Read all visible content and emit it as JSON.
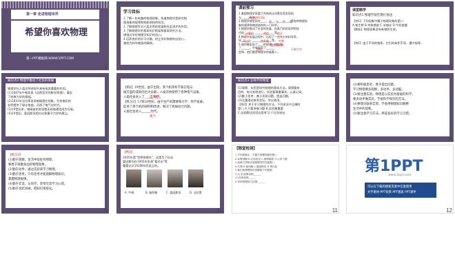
{
  "slides": [
    {
      "n": "1",
      "chapter": "第一章  走进物理世界",
      "title": "希望你喜欢物理",
      "footer": "第一PPT模板网-WWW.1PPT.COM"
    },
    {
      "n": "2",
      "heading": "学习目标",
      "lines": [
        "1.了解一些有趣的物理现象，知道物理学是研究物",
        "  理现象的规律和物质结构的科学。",
        "2.了解物理学对人类文明的发展和社会进步的作用。",
        "3.了解物理学的基本知识框架和基本研究方法，",
        "  增强对学好物理学知识的信心。",
        "4.培养良好的学习兴趣，树立学好物理的自信心，",
        "  激发为科学献身的精神。"
      ]
    },
    {
      "n": "3",
      "heading": "课前预习",
      "lines": [
        "1.美国物理学家富兰克林经过风筝实验发现电",
        "  与______有关。",
        "2.物理学就是研究____、____、____、____等各种物理现",
        "  象的规律和物质结构的一门科学。",
        "3.物理学推动了社会的发展，由蒸汽机的发明到现",
        "  代的______、______、______等。",
        "4.物理学发展过程中，出现了一些伟大的科学家，",
        "  如______、______、______等。",
        "5.伽利略发现了____的规律，他发现",
        "  了______，牛顿发现了______",
        "  定律，他们都是物理学的奠基人。"
      ],
      "answers": [
        "天空中的闪电",
        "声",
        "光",
        "热",
        "电",
        "计算机",
        "通信",
        "航天",
        "哥白尼",
        "伽利略",
        "牛顿",
        "摆的等时性",
        "惯性",
        "万有引力"
      ]
    },
    {
      "n": "4",
      "heading": "课堂精学",
      "sub": "知识点1 物理学就在我们身边",
      "lines": [
        "  【例1】下列现象中属于物理现象的是( )",
        "  A.铁生锈  B.木柴燃烧  C.冰熔化  D.牛奶变酸",
        "  【解析】物理现象没有新物质生成。",
        "【例1】由于不同的物质，它们的体积不同，遵守规律..."
      ]
    },
    {
      "n": "5",
      "sub": "知识点2 物理学推动了社会的发展",
      "lines": [
        "  物理学在人类文明进程中具有极其重要的作用。",
        "  (1)1687年牛顿发表《自然哲学的数学原理》，奠定",
        "  了经典力学的基础。",
        "  (2)1831年法拉第发现电磁感应现象，为发电机的",
        "  发明提供了理论依据，开辟了电气化时代。",
        "  (3)19世纪末，电磁波的发现使无线电通信成为可能。",
        "  (4)20世纪，爱因斯坦相对论和量子力学的建立。"
      ]
    },
    {
      "n": "6",
      "lines": [
        "【例2】19世纪，由于出现，蒸汽机等科学家在电与",
        "磁方面的成就的巨大贡献，人类开始使用了各种电气设备，",
        "人类社会进入了______时代。",
        "",
        "【练习2】17到18世纪，由于生产的需要和力学、热学发展，",
        "促进了蒸汽机的研制和改进，解决了机械动力问题，",
        "人类社会进入______时代。"
      ],
      "answers": [
        "电气化",
        "蒸汽"
      ]
    },
    {
      "n": "7",
      "sub": "知识点3 怎样学好物理",
      "lines": [
        "(1)观察、实验是研究物理的基本方法。观察要有",
        "目的、有计划地进行，实验要尊重事实，认真记录。",
        "(2)勤于思考、善于发现问题，提出问题。",
        "(3)注重理论联系实际，学以致用。",
        "",
        "【例3】关于学习物理的方法，下列说法中正确的",
        "是( )  A.只要多做习题  B.实验最重要",
        "C.边观察边实验边思考  D.只记住结论"
      ]
    },
    {
      "n": "8",
      "lines": [
        "(2)要积极思考，善于提出问题。",
        "学习物理要多观察，多动手，多动脑。",
        "(3)要注重实验。物理是以实验为基础的科学，",
        "要多动手做实验，学会科学探究的方法。",
        "(4)要理论联系实际，学会用物理知识解释",
        "生活中的现象。",
        "(5)要注意学习方法，养成良好的学习习惯。"
      ]
    },
    {
      "n": "9",
      "sub": "【练习3】",
      "lines": [
        "(1)勤于观察。生活中处处有物理，",
        "要善于观察身边的物理现象。",
        "(2)勤于动手。通过实验来学习物理。",
        "(3)勤于思考。只有思考才能理解物理知识，",
        "掌握物理规律。",
        "(4)勤于交流。与同学、老师交流学习心得。",
        "(5)勤于总结归纳，把知识系统化。"
      ]
    },
    {
      "n": "10",
      "sub": "【例3】",
      "lines": [
        "2005年是\"世界物理年\"，这是为了纪念",
        "爱因斯坦在1905年发表\"相对论\"等",
        "重要论文100周年而设立的。"
      ],
      "choices": [
        "A. 牛顿",
        "B. 伽利略",
        "C. 爱因斯坦",
        "D. 法拉第"
      ]
    },
    {
      "n": "11",
      "heading": "【随堂检测】",
      "lines": [
        "1.下列现象中，不属于物理现象的是( )",
        "A.冰雪消融  B.灯泡发光  C.食物腐败  D.火车飞驰",
        "2.经典力学和实验物理学的先驱是( )",
        "A.牛顿  B.伽利略  C.爱因斯坦  D.哥白尼",
        "3.我们用物理知识来解释下列现象:",
        "(1)小孔成像说明______",
        "(2)月食说明______",
        "4.学好物理的方法是:______"
      ]
    },
    {
      "n": "12",
      "logo_main": "第1PPT",
      "logo_sub": "www.1ppt.com",
      "lines": [
        "可以在下载的模板资源中任意使用",
        "文字素材 PPT背景 PPT图表 PPT课件"
      ]
    }
  ]
}
